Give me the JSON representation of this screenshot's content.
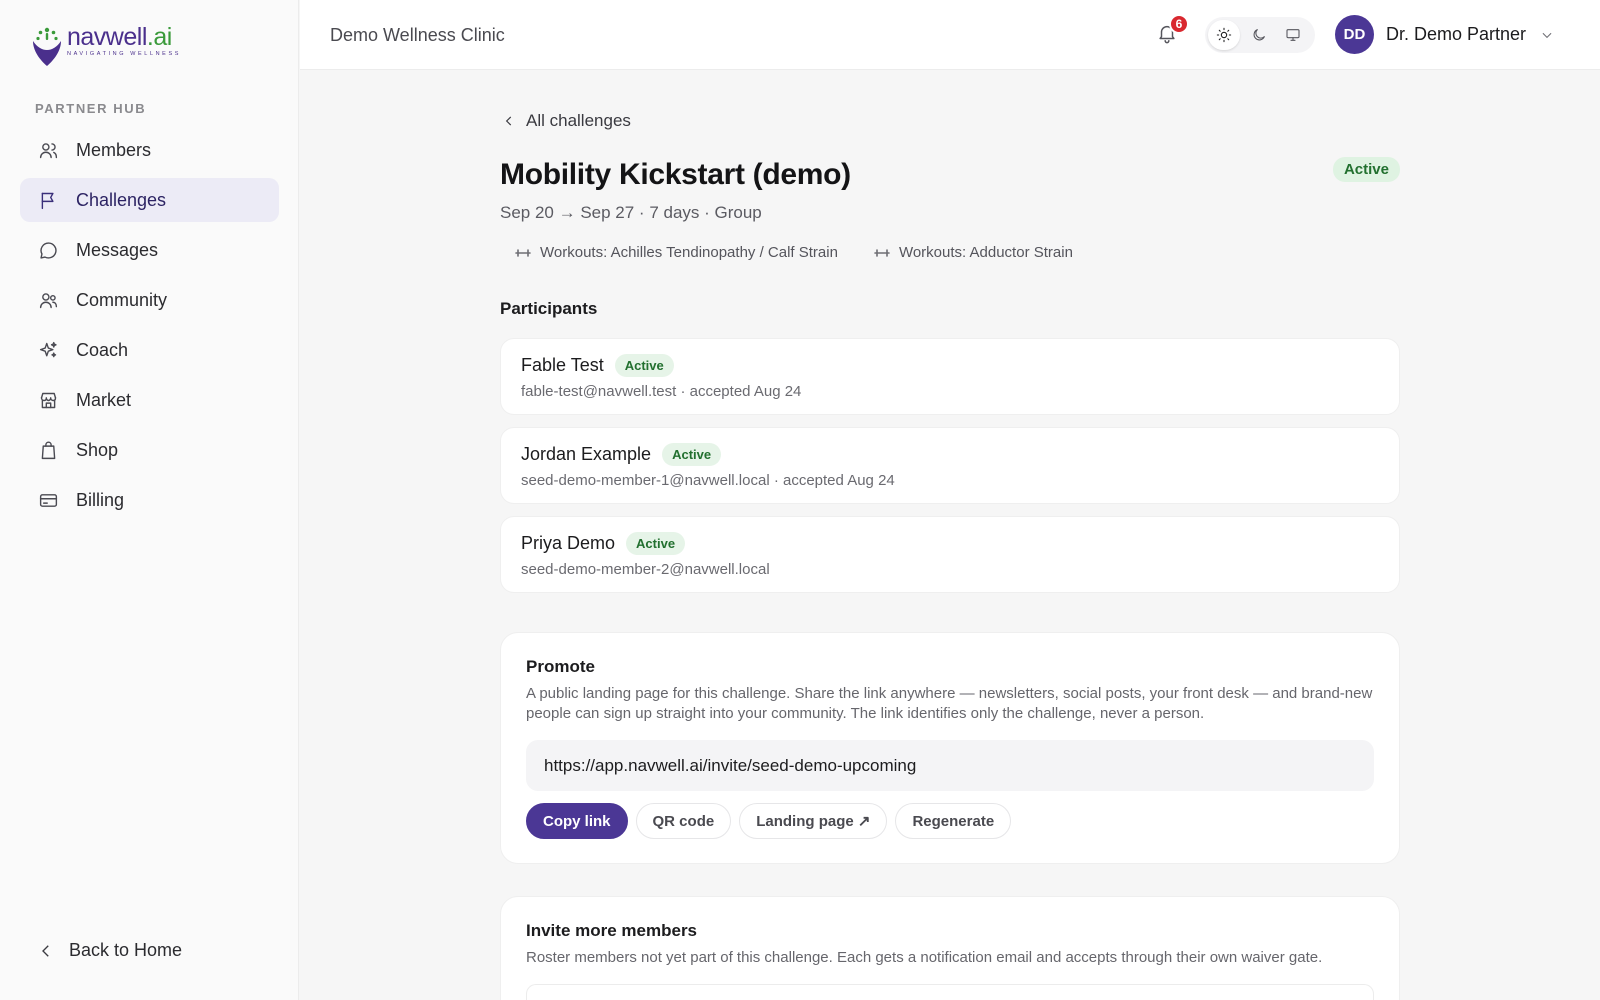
{
  "brand": {
    "name_main": "navwell",
    "name_suffix": ".ai",
    "tagline": "NAVIGATING WELLNESS"
  },
  "sidebar": {
    "section_label": "PARTNER HUB",
    "items": [
      {
        "label": "Members",
        "icon": "users-icon"
      },
      {
        "label": "Challenges",
        "icon": "flag-icon",
        "active": true
      },
      {
        "label": "Messages",
        "icon": "chat-bubble-icon"
      },
      {
        "label": "Community",
        "icon": "community-icon"
      },
      {
        "label": "Coach",
        "icon": "sparkles-icon"
      },
      {
        "label": "Market",
        "icon": "storefront-icon"
      },
      {
        "label": "Shop",
        "icon": "shopping-bag-icon"
      },
      {
        "label": "Billing",
        "icon": "credit-card-icon"
      }
    ],
    "back_home": "Back to Home"
  },
  "header": {
    "clinic_name": "Demo Wellness Clinic",
    "notification_count": "6",
    "theme_options": [
      "light",
      "dark",
      "system"
    ],
    "theme_selected": "light",
    "user": {
      "initials": "DD",
      "name": "Dr. Demo Partner"
    }
  },
  "challenge": {
    "back_label": "All challenges",
    "title": "Mobility Kickstart (demo)",
    "status": "Active",
    "meta": "Sep 20 → Sep 27 · 7 days · Group",
    "workouts": [
      "Workouts: Achilles Tendinopathy / Calf Strain",
      "Workouts: Adductor Strain"
    ]
  },
  "participants": {
    "title": "Participants",
    "list": [
      {
        "name": "Fable Test",
        "status": "Active",
        "detail": "fable-test@navwell.test · accepted Aug 24"
      },
      {
        "name": "Jordan Example",
        "status": "Active",
        "detail": "seed-demo-member-1@navwell.local · accepted Aug 24"
      },
      {
        "name": "Priya Demo",
        "status": "Active",
        "detail": "seed-demo-member-2@navwell.local"
      }
    ]
  },
  "promote": {
    "title": "Promote",
    "description": "A public landing page for this challenge. Share the link anywhere — newsletters, social posts, your front desk — and brand-new people can sign up straight into your community. The link identifies only the challenge, never a person.",
    "link": "https://app.navwell.ai/invite/seed-demo-upcoming",
    "buttons": {
      "copy": "Copy link",
      "qr": "QR code",
      "landing": "Landing page ↗",
      "regenerate": "Regenerate"
    }
  },
  "invite": {
    "title": "Invite more members",
    "description": "Roster members not yet part of this challenge. Each gets a notification email and accepts through their own waiver gate."
  },
  "colors": {
    "accent": "#4b3795",
    "active_bg": "#dff3e2",
    "active_text": "#22702f",
    "badge_red": "#d9282f"
  }
}
